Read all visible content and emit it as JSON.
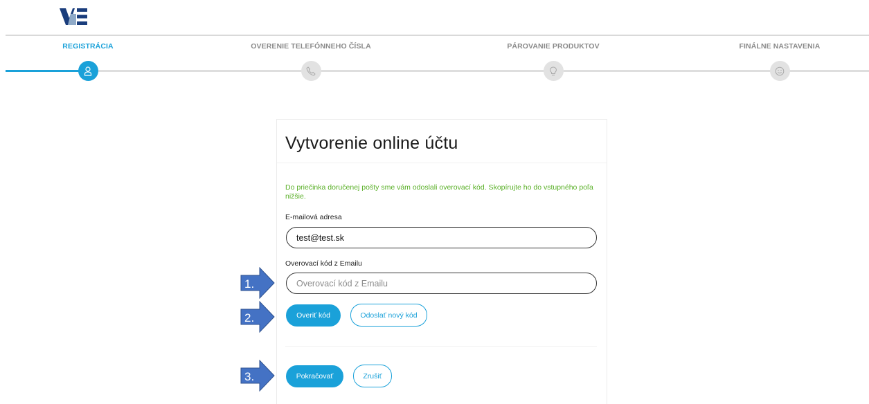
{
  "header": {
    "logo_text": "VSE"
  },
  "stepper": {
    "steps": [
      {
        "label": "REGISTRÁCIA",
        "icon": "user-icon",
        "active": true
      },
      {
        "label": "OVERENIE TELEFÓNNEHO ČÍSLA",
        "icon": "phone-icon",
        "active": false
      },
      {
        "label": "PÁROVANIE PRODUKTOV",
        "icon": "lightbulb-icon",
        "active": false
      },
      {
        "label": "FINÁLNE NASTAVENIA",
        "icon": "smiley-icon",
        "active": false
      }
    ]
  },
  "card": {
    "title": "Vytvorenie online účtu",
    "info": "Do priečinka doručenej pošty sme vám odoslali overovací kód. Skopírujte ho do vstupného poľa nižšie.",
    "email": {
      "label": "E-mailová adresa",
      "value": "test@test.sk"
    },
    "code": {
      "label": "Overovací kód z Emailu",
      "placeholder": "Overovací kód z Emailu",
      "value": ""
    },
    "buttons": {
      "verify": "Overiť kód",
      "resend": "Odoslať nový kód",
      "continue": "Pokračovať",
      "cancel": "Zrušiť"
    }
  },
  "annotations": [
    {
      "number": "1."
    },
    {
      "number": "2."
    },
    {
      "number": "3."
    }
  ],
  "colors": {
    "accent": "#1aa1d9",
    "info_text": "#5ab028",
    "inactive_step": "#e2e2e2",
    "annotation_arrow": "#4472c4"
  }
}
